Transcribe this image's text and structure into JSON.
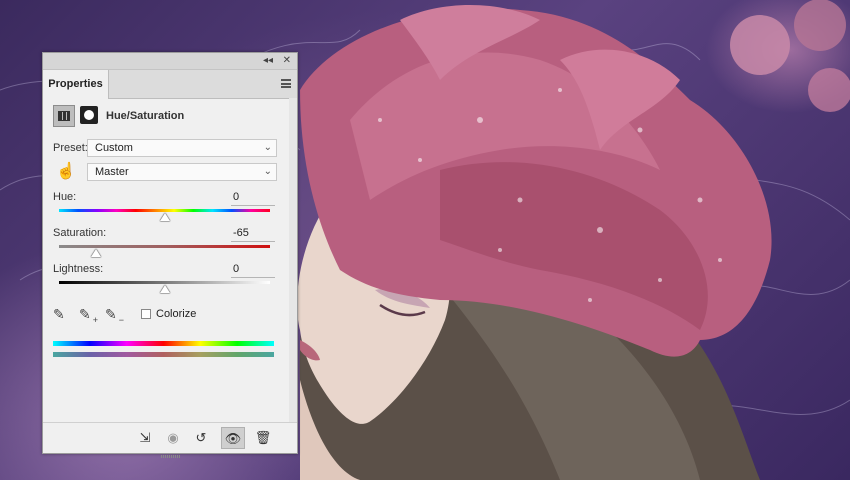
{
  "panel": {
    "collapse_glyph": "◂◂",
    "close_glyph": "✕",
    "tab_label": "Properties",
    "menu_icon": "panel-menu-icon",
    "adjustment_title": "Hue/Saturation"
  },
  "preset": {
    "label": "Preset:",
    "value": "Custom"
  },
  "channel": {
    "value": "Master"
  },
  "hue": {
    "label": "Hue:",
    "value": "0",
    "level": 0.5
  },
  "saturation": {
    "label": "Saturation:",
    "value": "-65",
    "level": 0.175
  },
  "lightness": {
    "label": "Lightness:",
    "value": "0",
    "level": 0.5
  },
  "colorize": {
    "label": "Colorize",
    "checked": false
  },
  "footer": {
    "buttons": [
      "clip-to-layer-icon",
      "view-previous-icon",
      "reset-icon",
      "visibility-icon",
      "trash-icon"
    ]
  },
  "colors": {
    "panel_bg": "#f0f0f0",
    "tab_bar": "#dcdcdc"
  }
}
